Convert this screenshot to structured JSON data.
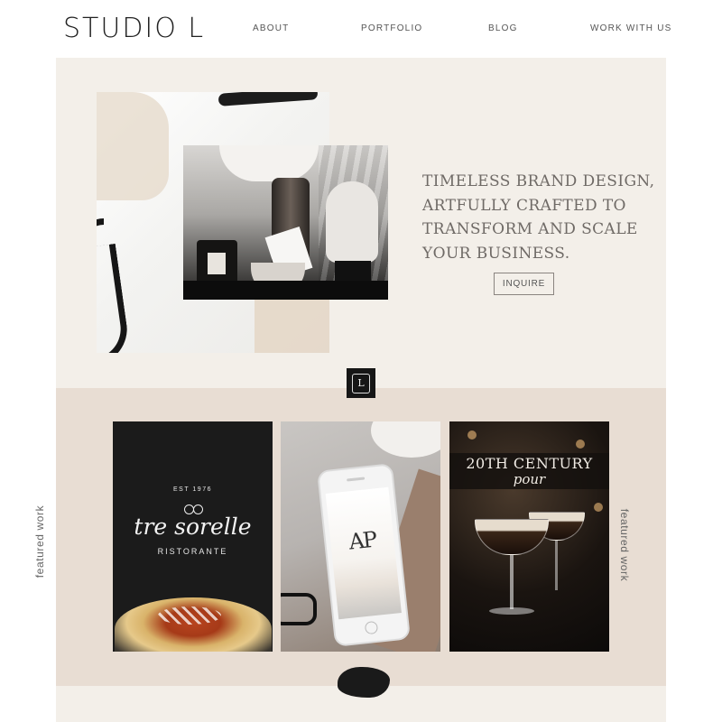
{
  "header": {
    "logo": "STUDIO L",
    "nav": [
      "ABOUT",
      "PORTFOLIO",
      "BLOG",
      "WORK WITH US"
    ]
  },
  "hero": {
    "tagline_lines": [
      "TIMELESS BRAND DESIGN,",
      "ARTFULLY CRAFTED TO",
      "TRANSFORM AND SCALE",
      "YOUR BUSINESS."
    ],
    "cta_label": "INQUIRE"
  },
  "monogram": "L",
  "featured": {
    "side_label_left": "featured work",
    "side_label_right": "featured work",
    "cards": [
      {
        "est": "EST 1976",
        "name": "tre sorelle",
        "subtitle": "RISTORANTE"
      },
      {
        "monogram": "AP"
      },
      {
        "title": "20TH CENTURY",
        "subtitle": "pour"
      }
    ]
  },
  "colors": {
    "hero_bg": "#f3efe9",
    "featured_bg": "#e8ddd3",
    "text": "#6f6a66",
    "dark": "#161616"
  }
}
